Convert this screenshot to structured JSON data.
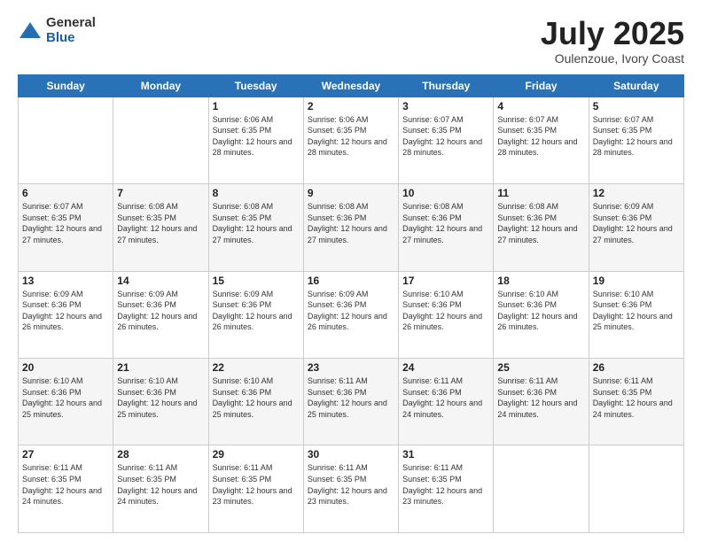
{
  "logo": {
    "general": "General",
    "blue": "Blue"
  },
  "title": {
    "month": "July 2025",
    "location": "Oulenzoue, Ivory Coast"
  },
  "days_of_week": [
    "Sunday",
    "Monday",
    "Tuesday",
    "Wednesday",
    "Thursday",
    "Friday",
    "Saturday"
  ],
  "weeks": [
    [
      {
        "day": "",
        "info": ""
      },
      {
        "day": "",
        "info": ""
      },
      {
        "day": "1",
        "info": "Sunrise: 6:06 AM\nSunset: 6:35 PM\nDaylight: 12 hours and 28 minutes."
      },
      {
        "day": "2",
        "info": "Sunrise: 6:06 AM\nSunset: 6:35 PM\nDaylight: 12 hours and 28 minutes."
      },
      {
        "day": "3",
        "info": "Sunrise: 6:07 AM\nSunset: 6:35 PM\nDaylight: 12 hours and 28 minutes."
      },
      {
        "day": "4",
        "info": "Sunrise: 6:07 AM\nSunset: 6:35 PM\nDaylight: 12 hours and 28 minutes."
      },
      {
        "day": "5",
        "info": "Sunrise: 6:07 AM\nSunset: 6:35 PM\nDaylight: 12 hours and 28 minutes."
      }
    ],
    [
      {
        "day": "6",
        "info": "Sunrise: 6:07 AM\nSunset: 6:35 PM\nDaylight: 12 hours and 27 minutes."
      },
      {
        "day": "7",
        "info": "Sunrise: 6:08 AM\nSunset: 6:35 PM\nDaylight: 12 hours and 27 minutes."
      },
      {
        "day": "8",
        "info": "Sunrise: 6:08 AM\nSunset: 6:35 PM\nDaylight: 12 hours and 27 minutes."
      },
      {
        "day": "9",
        "info": "Sunrise: 6:08 AM\nSunset: 6:36 PM\nDaylight: 12 hours and 27 minutes."
      },
      {
        "day": "10",
        "info": "Sunrise: 6:08 AM\nSunset: 6:36 PM\nDaylight: 12 hours and 27 minutes."
      },
      {
        "day": "11",
        "info": "Sunrise: 6:08 AM\nSunset: 6:36 PM\nDaylight: 12 hours and 27 minutes."
      },
      {
        "day": "12",
        "info": "Sunrise: 6:09 AM\nSunset: 6:36 PM\nDaylight: 12 hours and 27 minutes."
      }
    ],
    [
      {
        "day": "13",
        "info": "Sunrise: 6:09 AM\nSunset: 6:36 PM\nDaylight: 12 hours and 26 minutes."
      },
      {
        "day": "14",
        "info": "Sunrise: 6:09 AM\nSunset: 6:36 PM\nDaylight: 12 hours and 26 minutes."
      },
      {
        "day": "15",
        "info": "Sunrise: 6:09 AM\nSunset: 6:36 PM\nDaylight: 12 hours and 26 minutes."
      },
      {
        "day": "16",
        "info": "Sunrise: 6:09 AM\nSunset: 6:36 PM\nDaylight: 12 hours and 26 minutes."
      },
      {
        "day": "17",
        "info": "Sunrise: 6:10 AM\nSunset: 6:36 PM\nDaylight: 12 hours and 26 minutes."
      },
      {
        "day": "18",
        "info": "Sunrise: 6:10 AM\nSunset: 6:36 PM\nDaylight: 12 hours and 26 minutes."
      },
      {
        "day": "19",
        "info": "Sunrise: 6:10 AM\nSunset: 6:36 PM\nDaylight: 12 hours and 25 minutes."
      }
    ],
    [
      {
        "day": "20",
        "info": "Sunrise: 6:10 AM\nSunset: 6:36 PM\nDaylight: 12 hours and 25 minutes."
      },
      {
        "day": "21",
        "info": "Sunrise: 6:10 AM\nSunset: 6:36 PM\nDaylight: 12 hours and 25 minutes."
      },
      {
        "day": "22",
        "info": "Sunrise: 6:10 AM\nSunset: 6:36 PM\nDaylight: 12 hours and 25 minutes."
      },
      {
        "day": "23",
        "info": "Sunrise: 6:11 AM\nSunset: 6:36 PM\nDaylight: 12 hours and 25 minutes."
      },
      {
        "day": "24",
        "info": "Sunrise: 6:11 AM\nSunset: 6:36 PM\nDaylight: 12 hours and 24 minutes."
      },
      {
        "day": "25",
        "info": "Sunrise: 6:11 AM\nSunset: 6:36 PM\nDaylight: 12 hours and 24 minutes."
      },
      {
        "day": "26",
        "info": "Sunrise: 6:11 AM\nSunset: 6:35 PM\nDaylight: 12 hours and 24 minutes."
      }
    ],
    [
      {
        "day": "27",
        "info": "Sunrise: 6:11 AM\nSunset: 6:35 PM\nDaylight: 12 hours and 24 minutes."
      },
      {
        "day": "28",
        "info": "Sunrise: 6:11 AM\nSunset: 6:35 PM\nDaylight: 12 hours and 24 minutes."
      },
      {
        "day": "29",
        "info": "Sunrise: 6:11 AM\nSunset: 6:35 PM\nDaylight: 12 hours and 23 minutes."
      },
      {
        "day": "30",
        "info": "Sunrise: 6:11 AM\nSunset: 6:35 PM\nDaylight: 12 hours and 23 minutes."
      },
      {
        "day": "31",
        "info": "Sunrise: 6:11 AM\nSunset: 6:35 PM\nDaylight: 12 hours and 23 minutes."
      },
      {
        "day": "",
        "info": ""
      },
      {
        "day": "",
        "info": ""
      }
    ]
  ]
}
